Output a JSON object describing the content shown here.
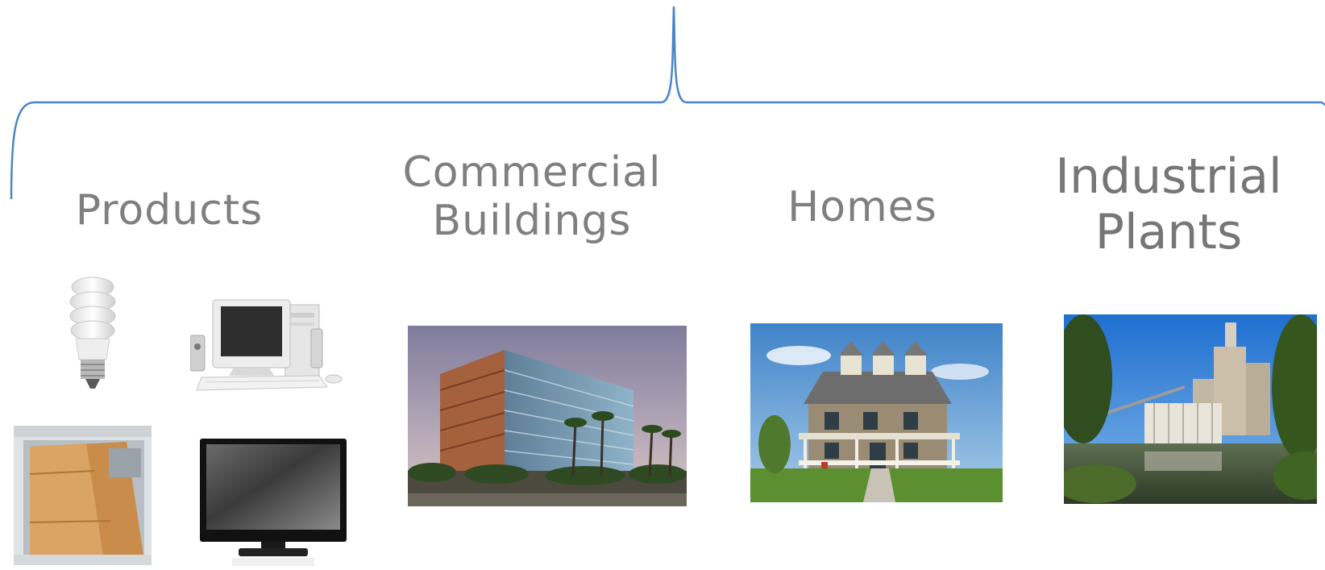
{
  "categories": {
    "products": {
      "label": "Products"
    },
    "commercial": {
      "label_line1": "Commercial",
      "label_line2": "Buildings"
    },
    "homes": {
      "label": "Homes"
    },
    "industrial": {
      "label_line1": "Industrial",
      "label_line2": "Plants"
    }
  },
  "images": {
    "bulb": "cfl-bulb-icon",
    "computer": "desktop-computer-icon",
    "dishwasher": "dishwasher-icon",
    "tv": "flat-screen-tv-icon",
    "office": "office-building-photo",
    "house": "house-photo",
    "plant": "industrial-plant-photo"
  },
  "colors": {
    "brace": "#4a86c5",
    "label": "#7f7f7f"
  }
}
